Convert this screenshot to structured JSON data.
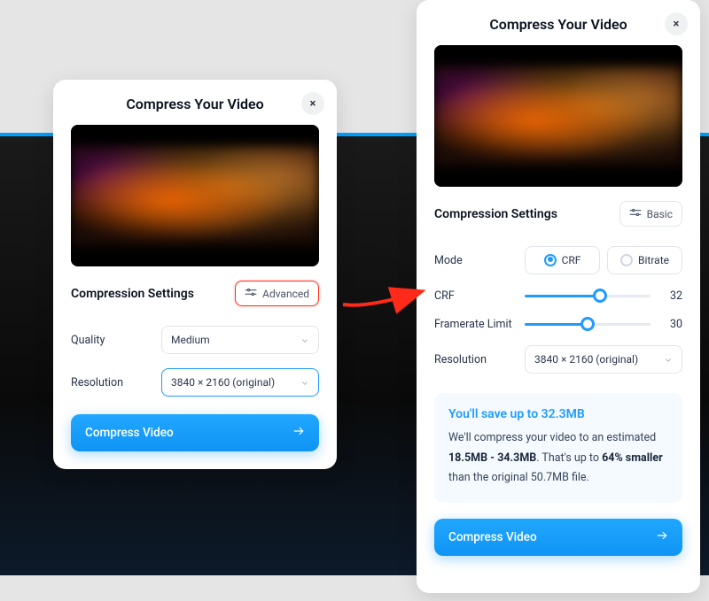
{
  "left": {
    "title": "Compress Your Video",
    "close_aria": "×",
    "settings_label": "Compression Settings",
    "mode_toggle_label": "Advanced",
    "quality_label": "Quality",
    "quality_value": "Medium",
    "resolution_label": "Resolution",
    "resolution_value": "3840 × 2160 (original)",
    "cta": "Compress Video"
  },
  "right": {
    "title": "Compress Your Video",
    "close_aria": "×",
    "settings_label": "Compression Settings",
    "mode_toggle_label": "Basic",
    "mode_label": "Mode",
    "mode_opts": {
      "crf": "CRF",
      "bitrate": "Bitrate"
    },
    "crf_label": "CRF",
    "crf_value": "32",
    "crf_fill_pct": 60,
    "fr_label": "Framerate Limit",
    "fr_value": "30",
    "fr_fill_pct": 50,
    "resolution_label": "Resolution",
    "resolution_value": "3840 × 2160 (original)",
    "save_head": "You'll save up to 32.3MB",
    "save_body_1": "We'll compress your video to an estimated ",
    "save_range": "18.5MB - 34.3MB",
    "save_body_2": ". That's up to ",
    "save_pct": "64% smaller",
    "save_body_3": " than the original 50.7MB file.",
    "cta": "Compress Video"
  }
}
